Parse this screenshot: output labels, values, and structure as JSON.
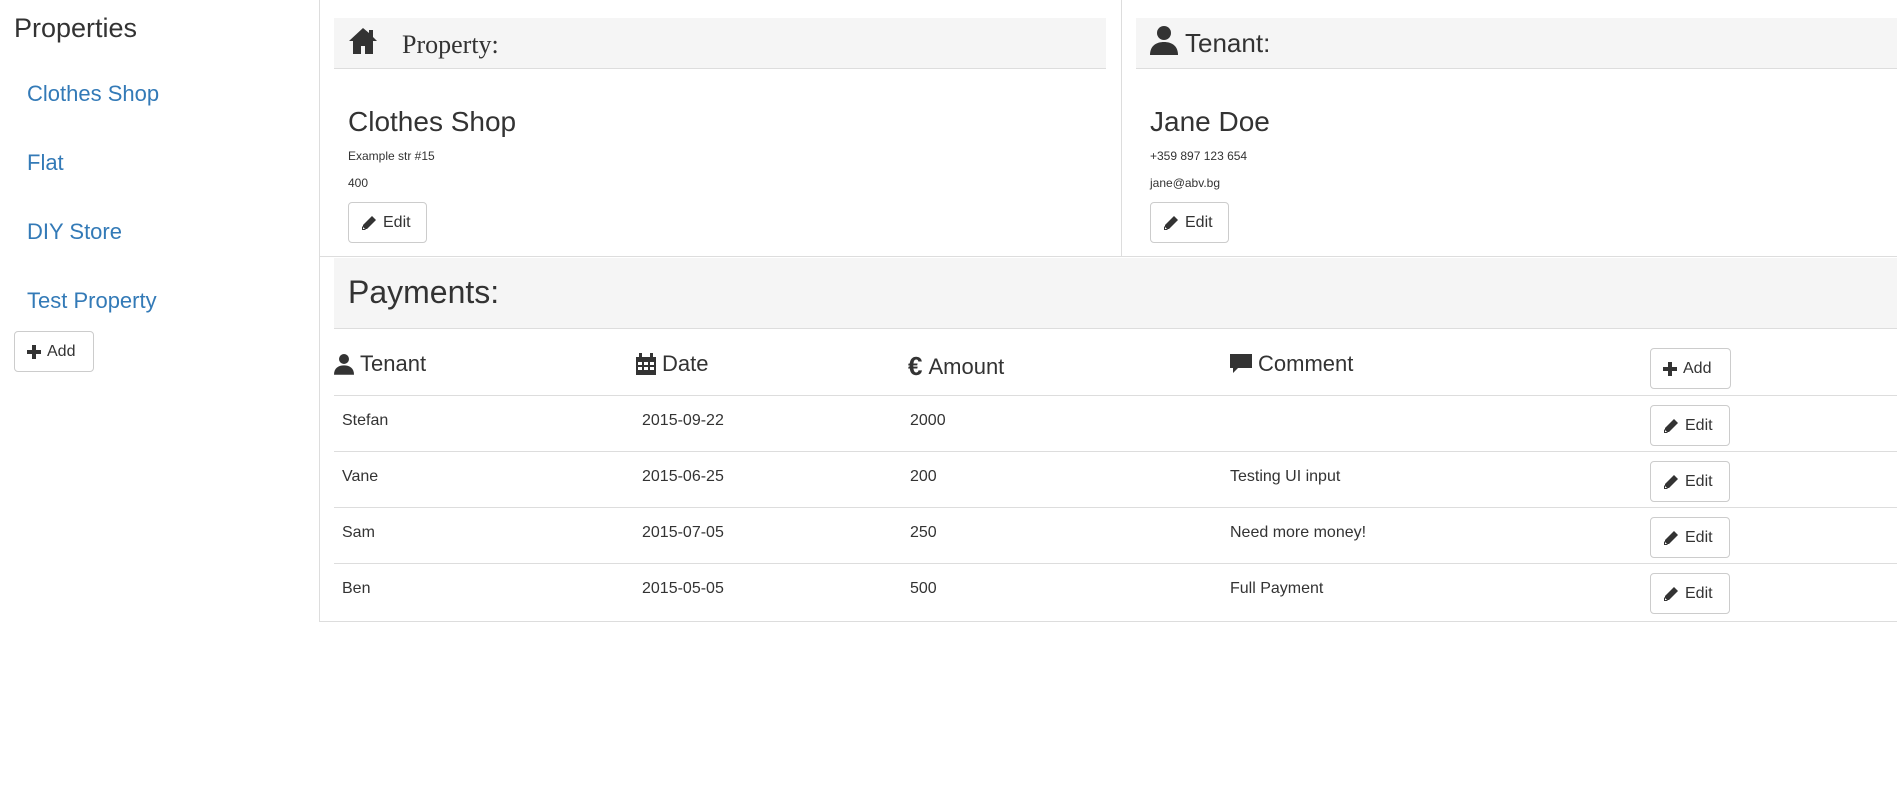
{
  "sidebar": {
    "title": "Properties",
    "items": [
      {
        "label": "Clothes Shop"
      },
      {
        "label": "Flat"
      },
      {
        "label": "DIY Store"
      },
      {
        "label": "Test Property"
      }
    ],
    "add_label": "Add"
  },
  "property": {
    "header": "Property:",
    "name": "Clothes Shop",
    "address": "Example str #15",
    "value": "400",
    "edit_label": "Edit"
  },
  "tenant": {
    "header": "Tenant:",
    "name": "Jane Doe",
    "phone": "+359 897 123 654",
    "email": "jane@abv.bg",
    "edit_label": "Edit"
  },
  "payments": {
    "header": "Payments:",
    "columns": {
      "tenant": "Tenant",
      "date": "Date",
      "amount": "Amount",
      "comment": "Comment"
    },
    "add_label": "Add",
    "rows": [
      {
        "tenant": "Stefan",
        "date": "2015-09-22",
        "amount": "2000",
        "comment": "",
        "edit": "Edit"
      },
      {
        "tenant": "Vane",
        "date": "2015-06-25",
        "amount": "200",
        "comment": "Testing UI input",
        "edit": "Edit"
      },
      {
        "tenant": "Sam",
        "date": "2015-07-05",
        "amount": "250",
        "comment": "Need more money!",
        "edit": "Edit"
      },
      {
        "tenant": "Ben",
        "date": "2015-05-05",
        "amount": "500",
        "comment": "Full Payment",
        "edit": "Edit"
      }
    ]
  },
  "colors": {
    "link": "#337ab7",
    "text": "#333333",
    "panel_bg": "#f5f5f5",
    "border": "#dddddd"
  },
  "icons": [
    "home-icon",
    "user-icon",
    "calendar-icon",
    "euro-icon",
    "comment-icon",
    "pencil-icon",
    "plus-icon"
  ]
}
